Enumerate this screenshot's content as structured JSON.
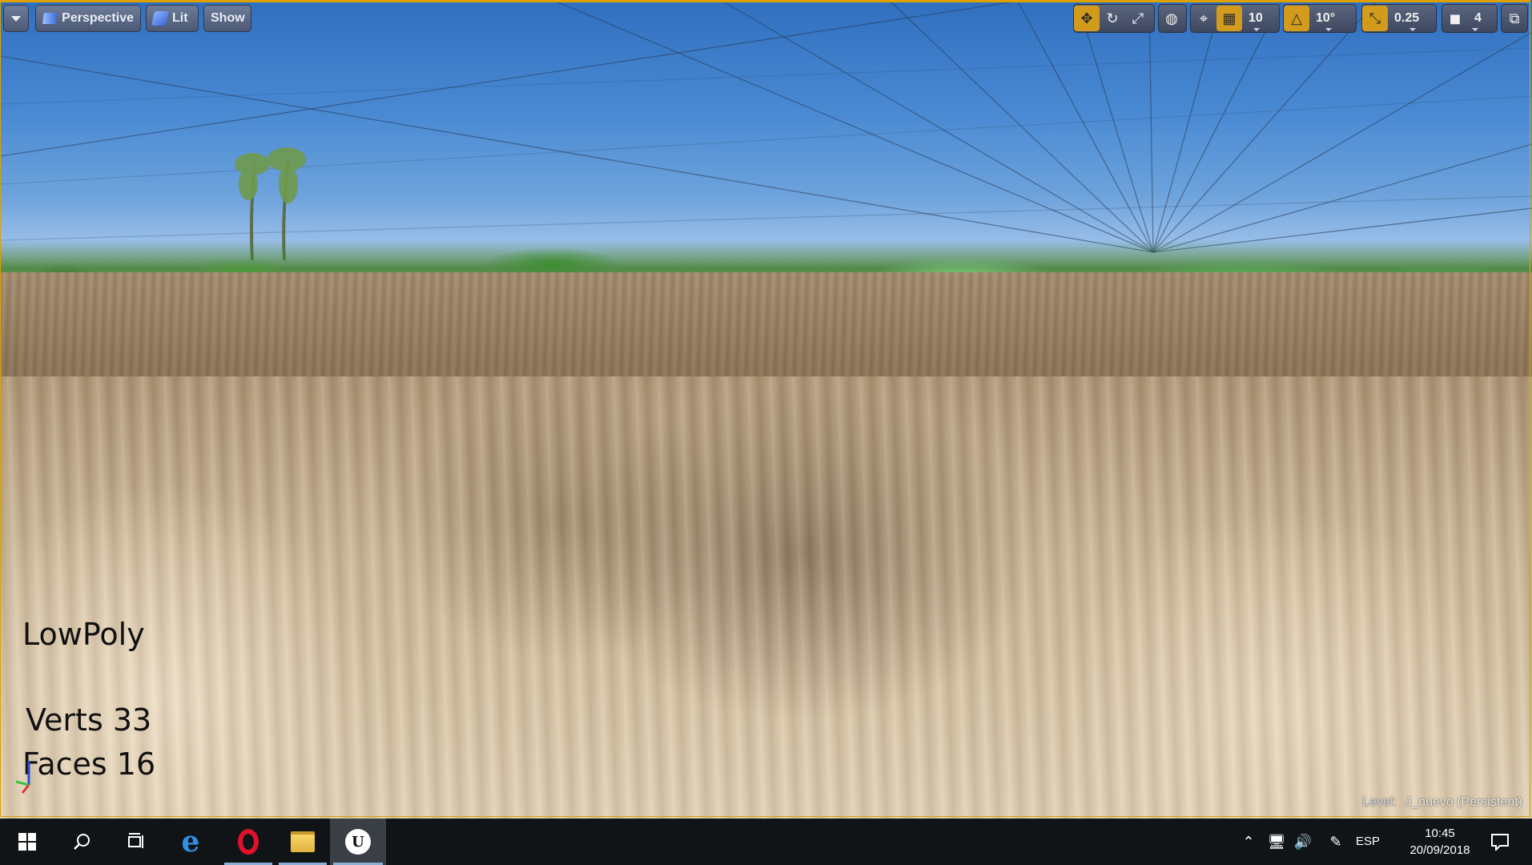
{
  "viewport": {
    "toolbar_left": {
      "perspective_label": "Perspective",
      "lit_label": "Lit",
      "show_label": "Show"
    },
    "toolbar_right": {
      "grid_snap_value": "10",
      "rotation_snap_value": "10°",
      "scale_snap_value": "0.25",
      "camera_speed_value": "4",
      "active_color": "#d39b1b"
    },
    "overlay": {
      "name": "LowPoly",
      "verts": "Verts 33",
      "faces": "Faces 16"
    },
    "level": {
      "label": "Level:",
      "name": "J_nuevo (Persistent)"
    }
  },
  "taskbar": {
    "icons": [
      "windows-start-icon",
      "search-icon",
      "task-view-icon",
      "edge-icon",
      "opera-icon",
      "file-explorer-icon",
      "unreal-engine-icon"
    ],
    "tray": {
      "language": "ESP",
      "time": "10:45",
      "date": "20/09/2018"
    }
  }
}
